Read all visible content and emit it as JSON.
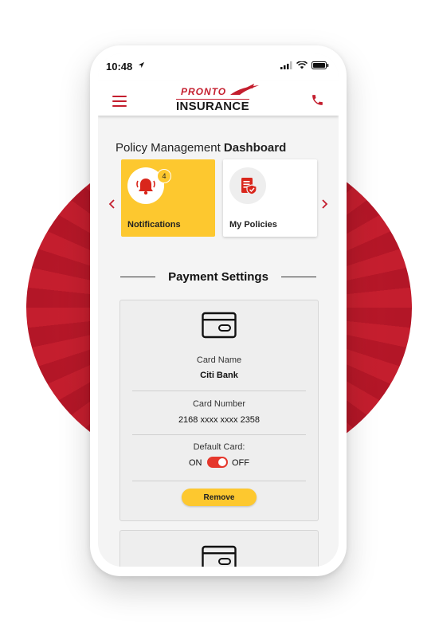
{
  "status_bar": {
    "time": "10:48"
  },
  "header": {
    "logo_top": "PRONTO",
    "logo_bottom": "INSURANCE"
  },
  "page": {
    "title_prefix": "Policy Management",
    "title_bold": "Dashboard"
  },
  "tiles": [
    {
      "label": "Notifications",
      "badge": "4",
      "icon": "bell-icon"
    },
    {
      "label": "My Policies",
      "icon": "policy-document-icon"
    }
  ],
  "payment": {
    "section_title": "Payment Settings",
    "card": {
      "name_label": "Card Name",
      "name_value": "Citi Bank",
      "number_label": "Card Number",
      "number_value": "2168 xxxx xxxx 2358",
      "default_label": "Default Card:",
      "toggle_on": "ON",
      "toggle_off": "OFF",
      "default_enabled": true,
      "remove_label": "Remove"
    }
  },
  "colors": {
    "brand_red": "#c41e2e",
    "brand_yellow": "#fdc82f",
    "toggle_red": "#e5372c"
  }
}
